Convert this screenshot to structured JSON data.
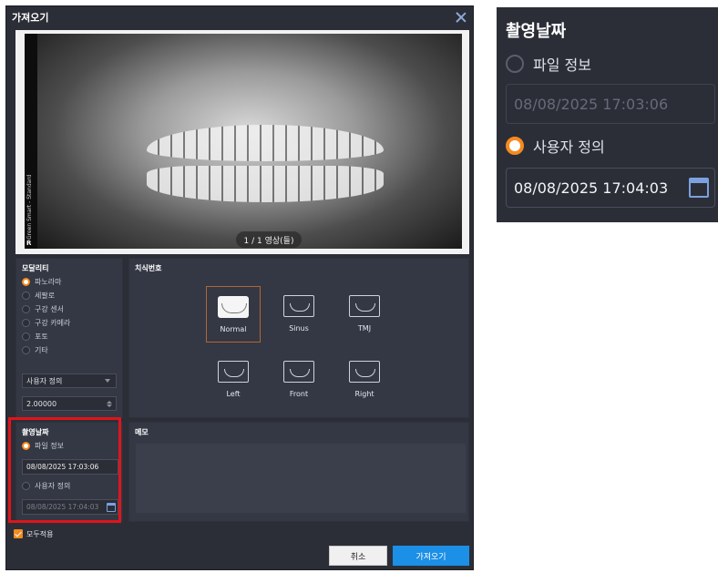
{
  "dialog": {
    "title": "가져오기"
  },
  "preview": {
    "side_text": "Green Smart - Standard",
    "side_marker": "R",
    "page_indicator": "1 / 1 영상(들)"
  },
  "modality": {
    "title": "모달리티",
    "options": [
      {
        "label": "파노라마",
        "selected": true
      },
      {
        "label": "세팔로",
        "selected": false
      },
      {
        "label": "구강 센서",
        "selected": false
      },
      {
        "label": "구강 카메라",
        "selected": false
      },
      {
        "label": "포토",
        "selected": false
      },
      {
        "label": "기타",
        "selected": false
      }
    ],
    "preset_select": "사용자 정의",
    "value_input": "2.00000"
  },
  "tooth_number": {
    "title": "치식번호",
    "tiles": [
      {
        "label": "Normal",
        "selected": true
      },
      {
        "label": "Sinus",
        "selected": false
      },
      {
        "label": "TMJ",
        "selected": false
      },
      {
        "label": "Left",
        "selected": false
      },
      {
        "label": "Front",
        "selected": false
      },
      {
        "label": "Right",
        "selected": false
      }
    ]
  },
  "capture_date": {
    "title": "촬영날짜",
    "option_file": "파일 정보",
    "file_date": "08/08/2025 17:03:06",
    "option_custom": "사용자 정의",
    "custom_date": "08/08/2025 17:04:03"
  },
  "memo": {
    "title": "메모"
  },
  "apply_all": {
    "label": "모두적용",
    "checked": true
  },
  "buttons": {
    "cancel": "취소",
    "import": "가져오기"
  },
  "zoom": {
    "title": "촬영날짜",
    "option_file": "파일 정보",
    "file_date": "08/08/2025 17:03:06",
    "option_custom": "사용자 정의",
    "custom_date": "08/08/2025 17:04:03"
  },
  "colors": {
    "accent": "#f58a1f",
    "primary_button": "#1c8fe6",
    "highlight": "#e0141a",
    "panel": "#343844",
    "background": "#2b2e37"
  }
}
